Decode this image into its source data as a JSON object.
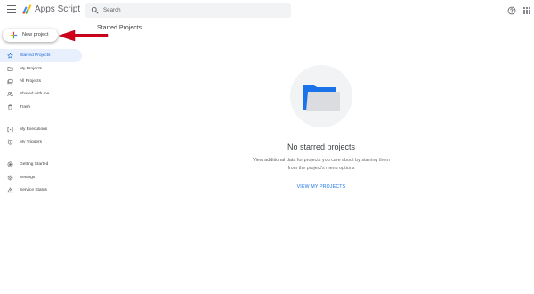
{
  "header": {
    "app_title": "Apps Script",
    "search_placeholder": "Search",
    "menu_icon": "hamburger-menu-icon",
    "logo_icon": "apps-script-logo",
    "help_icon": "help-circle-icon",
    "apps_icon": "google-apps-grid-icon"
  },
  "new_project": {
    "label": "New project",
    "icon": "plus-icon",
    "annotation_color": "#d0021b"
  },
  "sidebar": {
    "items": [
      {
        "label": "Starred Projects",
        "icon": "star-icon",
        "active": true
      },
      {
        "label": "My Projects",
        "icon": "folder-icon",
        "active": false
      },
      {
        "label": "All Projects",
        "icon": "folders-icon",
        "active": false
      },
      {
        "label": "Shared with me",
        "icon": "people-icon",
        "active": false
      },
      {
        "label": "Trash",
        "icon": "trash-icon",
        "active": false
      },
      {
        "label": "My Executions",
        "icon": "executions-icon",
        "active": false
      },
      {
        "label": "My Triggers",
        "icon": "clock-icon",
        "active": false
      },
      {
        "label": "Getting Started",
        "icon": "play-circle-icon",
        "active": false
      },
      {
        "label": "Settings",
        "icon": "gear-icon",
        "active": false
      },
      {
        "label": "Service Status",
        "icon": "warning-icon",
        "active": false
      }
    ]
  },
  "main": {
    "title": "Starred Projects",
    "empty_state": {
      "heading": "No starred projects",
      "description_line1": "View additional data for projects you care about by starring them",
      "description_line2": "from the project's menu options",
      "link_label": "VIEW MY PROJECTS",
      "illustration": "folder-illustration"
    }
  },
  "colors": {
    "accent_blue": "#1a73e8",
    "active_bg": "#e8f0fe",
    "active_text": "#1967d2",
    "search_bg": "#f1f3f4"
  }
}
